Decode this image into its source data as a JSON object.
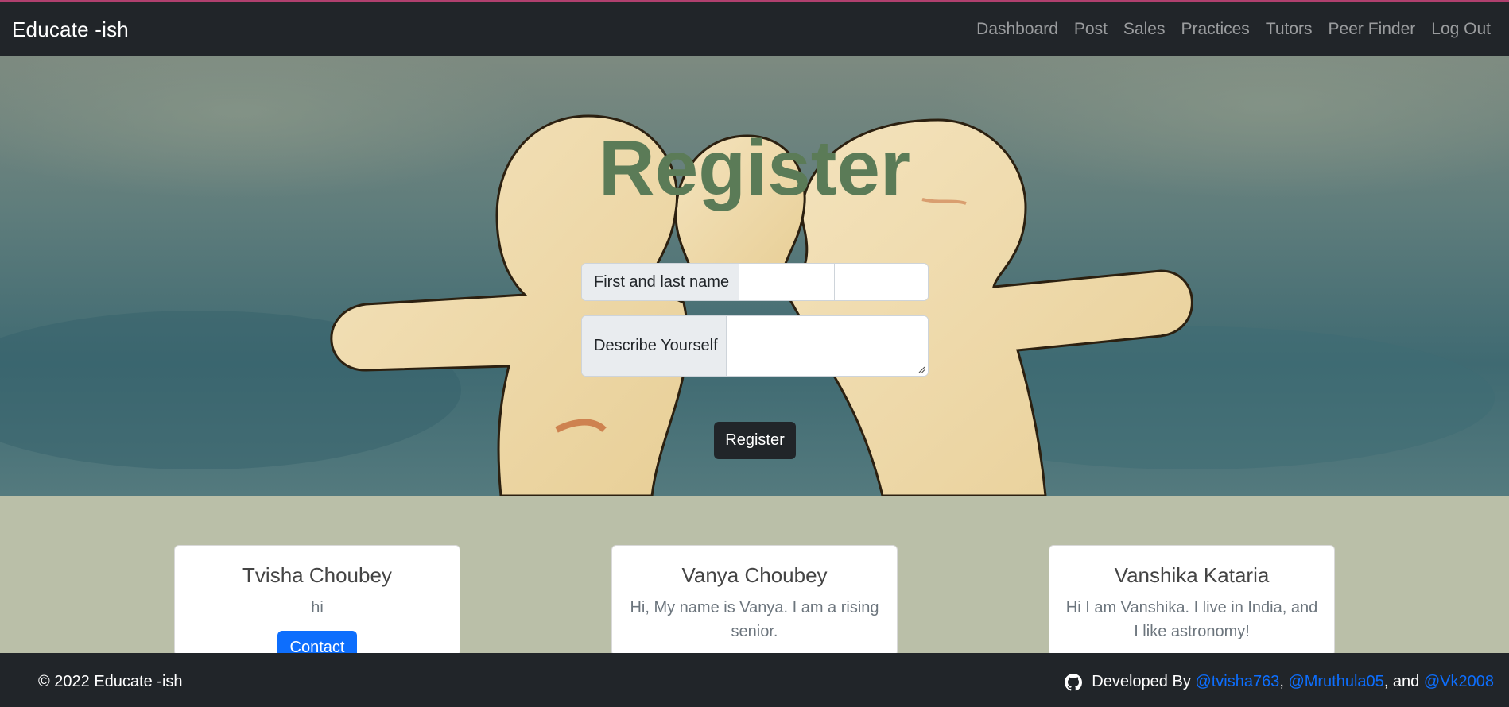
{
  "navbar": {
    "brand": "Educate -ish",
    "links": [
      "Dashboard",
      "Post",
      "Sales",
      "Practices",
      "Tutors",
      "Peer Finder",
      "Log Out"
    ]
  },
  "hero": {
    "title": "Register",
    "name_label": "First and last name",
    "describe_label": "Describe Yourself",
    "register_button": "Register"
  },
  "cards": [
    {
      "name": "Tvisha Choubey",
      "description": "hi",
      "contact": "Contact"
    },
    {
      "name": "Vanya Choubey",
      "description": "Hi, My name is Vanya. I am a rising senior."
    },
    {
      "name": "Vanshika Kataria",
      "description": "Hi I am Vanshika. I live in India, and I like astronomy!"
    }
  ],
  "footer": {
    "copyright": "© 2022 Educate -ish",
    "developed_by": "Developed By",
    "dev1": "@tvisha763",
    "sep1": ",",
    "dev2": "@Mruthula05",
    "sep2": ", and",
    "dev3": "@Vk2008"
  },
  "colors": {
    "navbar": "#212529",
    "title": "#5b7b57",
    "link": "#0d6efd",
    "page_bg": "#babfa8"
  }
}
